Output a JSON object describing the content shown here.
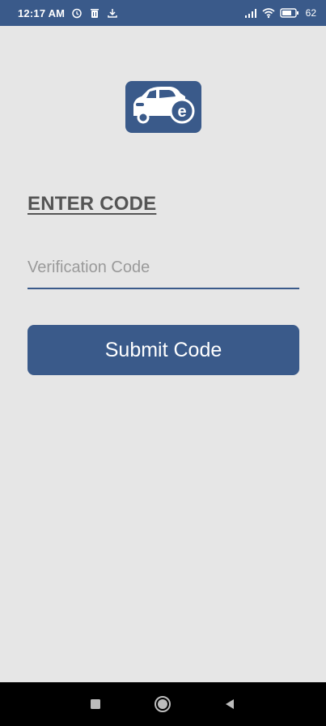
{
  "status_bar": {
    "time": "12:17 AM",
    "battery_percent": "62",
    "icons": [
      "alarm-icon",
      "trash-icon",
      "download-icon",
      "signal-icon",
      "wifi-icon",
      "battery-icon"
    ]
  },
  "logo": {
    "letter": "e"
  },
  "form": {
    "title": "ENTER CODE",
    "code_placeholder": "Verification Code",
    "code_value": "",
    "submit_label": "Submit Code"
  },
  "nav_bar": {
    "icons": [
      "recents-square-icon",
      "home-circle-icon",
      "back-triangle-icon"
    ]
  },
  "colors": {
    "primary": "#3a5a8a",
    "background": "#e6e6e6",
    "title": "#555555",
    "placeholder": "#9a9a9a"
  }
}
